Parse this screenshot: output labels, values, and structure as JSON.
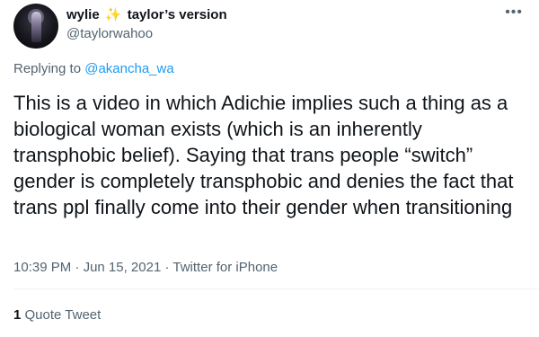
{
  "author": {
    "name_part1": "wylie",
    "sparkle": "✨",
    "name_part2": "taylor’s version",
    "handle": "@taylorwahoo"
  },
  "more_icon": "•••",
  "reply": {
    "prefix": "Replying to",
    "mention": "@akancha_wa"
  },
  "tweet": {
    "text": "This is a video in which Adichie implies such a thing as a biological woman exists (which is an inherently transphobic belief). Saying that trans people “switch” gender is completely transphobic and denies the fact that trans ppl finally come into their gender when transitioning"
  },
  "meta": {
    "time": "10:39 PM",
    "date": "Jun 15, 2021",
    "source": "Twitter for iPhone",
    "separator": "·"
  },
  "stats": {
    "quote_count": "1",
    "quote_label": "Quote Tweet"
  },
  "colors": {
    "text": "#0f1419",
    "secondary": "#536471",
    "link": "#1d9bf0",
    "sparkle": "#f2b705"
  }
}
